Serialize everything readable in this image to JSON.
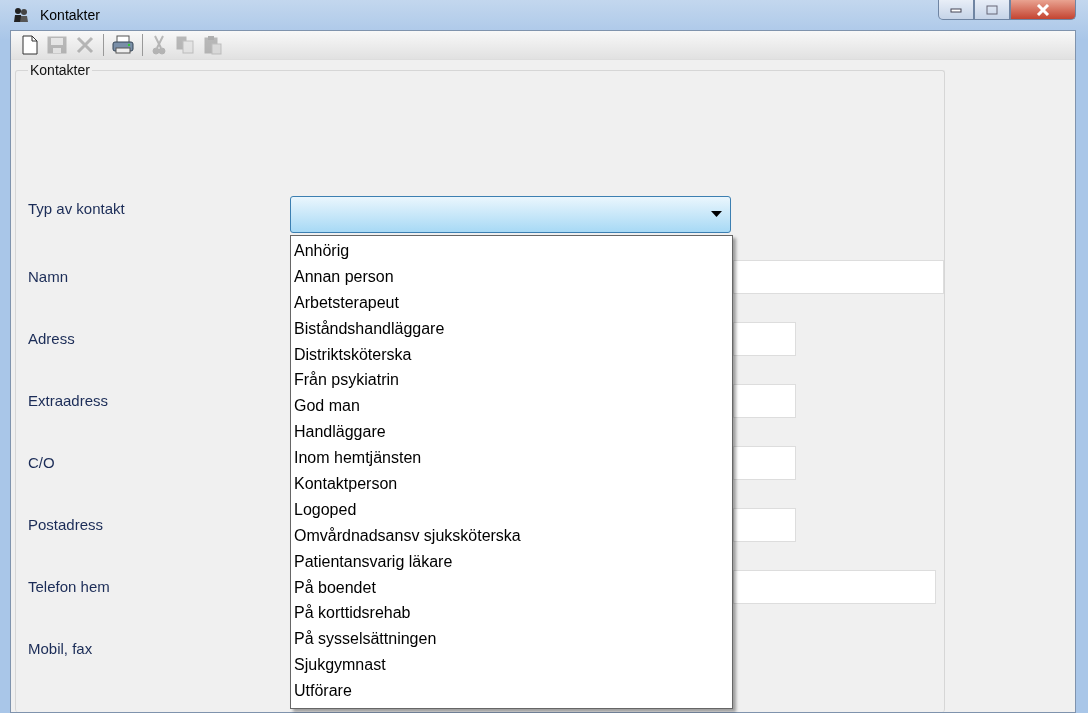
{
  "window": {
    "title": "Kontakter"
  },
  "toolbar": [
    {
      "kind": "new",
      "disabled": false
    },
    {
      "kind": "save",
      "disabled": true
    },
    {
      "kind": "delete",
      "disabled": true
    },
    {
      "kind": "separator"
    },
    {
      "kind": "print",
      "disabled": false
    },
    {
      "kind": "separator"
    },
    {
      "kind": "cut",
      "disabled": true
    },
    {
      "kind": "copy",
      "disabled": true
    },
    {
      "kind": "paste",
      "disabled": true
    }
  ],
  "group": {
    "title": "Kontakter"
  },
  "contact_type": {
    "label": "Typ av kontakt",
    "expanded": true,
    "options": [
      {
        "label": "Anhörig",
        "selected": false
      },
      {
        "label": "Annan person",
        "selected": false
      },
      {
        "label": "Arbetsterapeut",
        "selected": false
      },
      {
        "label": "Biståndshandläggare",
        "selected": false
      },
      {
        "label": "Distriktsköterska",
        "selected": false
      },
      {
        "label": "Från psykiatrin",
        "selected": false
      },
      {
        "label": "God man",
        "selected": false
      },
      {
        "label": "Handläggare",
        "selected": false
      },
      {
        "label": "Inom hemtjänsten",
        "selected": false
      },
      {
        "label": "Kontaktperson",
        "selected": false
      },
      {
        "label": "Logoped",
        "selected": false
      },
      {
        "label": "Omvårdnadsansv sjuksköterska",
        "selected": false
      },
      {
        "label": "Patientansvarig läkare",
        "selected": false
      },
      {
        "label": "På boendet",
        "selected": false
      },
      {
        "label": "På korttidsrehab",
        "selected": false
      },
      {
        "label": "På sysselsättningen",
        "selected": false
      },
      {
        "label": "Sjukgymnast",
        "selected": false
      },
      {
        "label": "Utförare",
        "selected": false
      }
    ]
  },
  "fields": [
    {
      "label": "Namn",
      "kind": "long"
    },
    {
      "label": "Adress",
      "kind": "short"
    },
    {
      "label": "Extraadress",
      "kind": "short"
    },
    {
      "label": "C/O",
      "kind": "short"
    },
    {
      "label": "Postadress",
      "kind": "short"
    },
    {
      "label": "Telefon hem",
      "kind": "medium"
    },
    {
      "label": "Mobil, fax",
      "kind": "hidden"
    }
  ]
}
